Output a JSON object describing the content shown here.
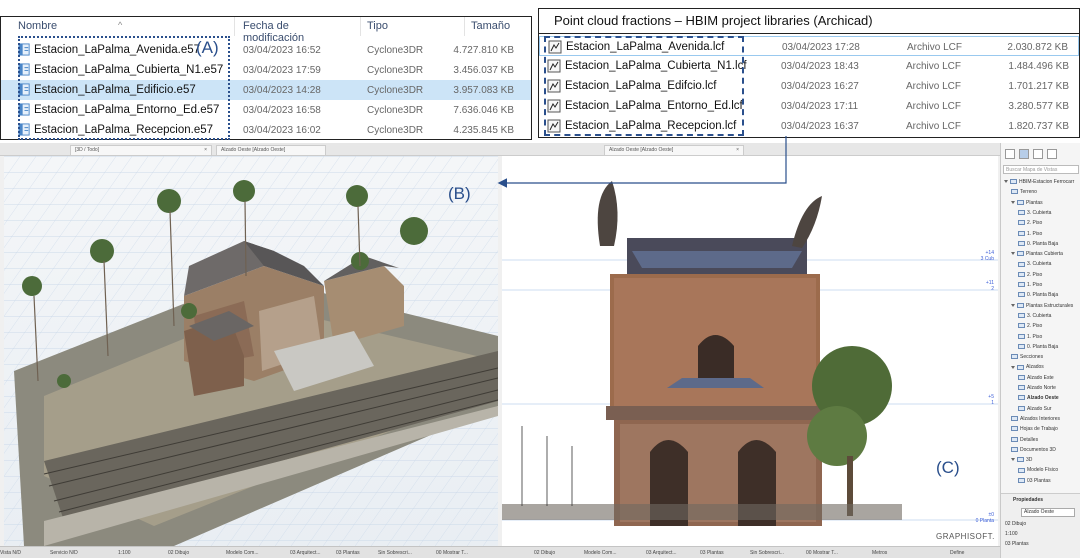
{
  "left_list": {
    "headers": {
      "name": "Nombre",
      "date": "Fecha de modificación",
      "type": "Tipo",
      "size": "Tamaño"
    },
    "rows": [
      {
        "name": "Estacion_LaPalma_Avenida.e57",
        "date": "03/04/2023 16:52",
        "type": "Cyclone3DR",
        "size": "4.727.810 KB",
        "selected": false
      },
      {
        "name": "Estacion_LaPalma_Cubierta_N1.e57",
        "date": "03/04/2023 17:59",
        "type": "Cyclone3DR",
        "size": "3.456.037 KB",
        "selected": false
      },
      {
        "name": "Estacion_LaPalma_Edificio.e57",
        "date": "03/04/2023 14:28",
        "type": "Cyclone3DR",
        "size": "3.957.083 KB",
        "selected": true
      },
      {
        "name": "Estacion_LaPalma_Entorno_Ed.e57",
        "date": "03/04/2023 16:58",
        "type": "Cyclone3DR",
        "size": "7.636.046 KB",
        "selected": false
      },
      {
        "name": "Estacion_LaPalma_Recepcion.e57",
        "date": "03/04/2023 16:02",
        "type": "Cyclone3DR",
        "size": "4.235.845 KB",
        "selected": false
      }
    ],
    "annotation": "(A)"
  },
  "right_list": {
    "title": "Point cloud fractions – HBIM project libraries (Archicad)",
    "rows": [
      {
        "name": "Estacion_LaPalma_Avenida.lcf",
        "date": "03/04/2023 17:28",
        "type": "Archivo LCF",
        "size": "2.030.872 KB"
      },
      {
        "name": "Estacion_LaPalma_Cubierta_N1.lcf",
        "date": "03/04/2023 18:43",
        "type": "Archivo LCF",
        "size": "1.484.496 KB"
      },
      {
        "name": "Estacion_LaPalma_Edifcio.lcf",
        "date": "03/04/2023 16:27",
        "type": "Archivo LCF",
        "size": "1.701.217 KB"
      },
      {
        "name": "Estacion_LaPalma_Entorno_Ed.lcf",
        "date": "03/04/2023 17:11",
        "type": "Archivo LCF",
        "size": "3.280.577 KB"
      },
      {
        "name": "Estacion_LaPalma_Recepcion.lcf",
        "date": "03/04/2023 16:37",
        "type": "Archivo LCF",
        "size": "1.820.737 KB"
      }
    ]
  },
  "tabs": {
    "view3d": "[3D / Todo]",
    "elev_left": "Alzado Oeste [Alzado Oeste]",
    "elev_main": "Alzado Oeste [Alzado Oeste]"
  },
  "annotations": {
    "b": "(B)",
    "c": "(C)"
  },
  "graphisoft": "GRAPHISOFT.",
  "levels": [
    {
      "value": "+14",
      "name": "3 Cub"
    },
    {
      "value": "+11",
      "name": "2"
    },
    {
      "value": "+5",
      "name": "1"
    },
    {
      "value": "±0",
      "name": "0 Planta"
    }
  ],
  "navigator": {
    "search_placeholder": "Buscar Mapa de Vistas",
    "items": [
      {
        "label": "HBIM-Estacion Ferrocarr",
        "depth": 0,
        "expander": true
      },
      {
        "label": "Terreno",
        "depth": 1,
        "expander": false
      },
      {
        "label": "Plantas",
        "depth": 1,
        "expander": true
      },
      {
        "label": "3. Cubierta",
        "depth": 2,
        "expander": false
      },
      {
        "label": "2. Piso",
        "depth": 2,
        "expander": false
      },
      {
        "label": "1. Piso",
        "depth": 2,
        "expander": false
      },
      {
        "label": "0. Planta Baja",
        "depth": 2,
        "expander": false
      },
      {
        "label": "Plantas Cubierta",
        "depth": 1,
        "expander": true
      },
      {
        "label": "3. Cubierta",
        "depth": 2,
        "expander": false
      },
      {
        "label": "2. Piso",
        "depth": 2,
        "expander": false
      },
      {
        "label": "1. Piso",
        "depth": 2,
        "expander": false
      },
      {
        "label": "0. Planta Baja",
        "depth": 2,
        "expander": false
      },
      {
        "label": "Plantas Estructurales",
        "depth": 1,
        "expander": true
      },
      {
        "label": "3. Cubierta",
        "depth": 2,
        "expander": false
      },
      {
        "label": "2. Piso",
        "depth": 2,
        "expander": false
      },
      {
        "label": "1. Piso",
        "depth": 2,
        "expander": false
      },
      {
        "label": "0. Planta Baja",
        "depth": 2,
        "expander": false
      },
      {
        "label": "Secciones",
        "depth": 1,
        "expander": false
      },
      {
        "label": "Alzados",
        "depth": 1,
        "expander": true
      },
      {
        "label": "Alzado Este",
        "depth": 2,
        "expander": false
      },
      {
        "label": "Alzado Norte",
        "depth": 2,
        "expander": false
      },
      {
        "label": "Alzado Oeste",
        "depth": 2,
        "expander": false,
        "selected": true
      },
      {
        "label": "Alzado Sur",
        "depth": 2,
        "expander": false
      },
      {
        "label": "Alzados Interiores",
        "depth": 1,
        "expander": false
      },
      {
        "label": "Hojas de Trabajo",
        "depth": 1,
        "expander": false
      },
      {
        "label": "Detalles",
        "depth": 1,
        "expander": false
      },
      {
        "label": "Documentos 3D",
        "depth": 1,
        "expander": false
      },
      {
        "label": "3D",
        "depth": 1,
        "expander": true
      },
      {
        "label": "Modelo Físico",
        "depth": 2,
        "expander": false
      },
      {
        "label": "03 Plantas",
        "depth": 2,
        "expander": false
      }
    ],
    "properties": {
      "title": "Propiedades",
      "view_name": "Alzado Oeste",
      "layer": "02 Dibujo",
      "scale": "1:100",
      "set": "03 Plantas"
    }
  },
  "statusbar": {
    "left": [
      "Vista N/D",
      "Servicio N/D",
      "1:100",
      "02 Dibujo",
      "Modelo Com...",
      "03 Arquitect...",
      "03 Plantas",
      "Sin Sobrescri...",
      "00 Mostrar T..."
    ],
    "right": [
      "02 Dibujo",
      "Modelo Com...",
      "03 Arquitect...",
      "03 Plantas",
      "Sin Sobrescri...",
      "00 Mostrar T...",
      "Metros",
      "Define"
    ]
  }
}
